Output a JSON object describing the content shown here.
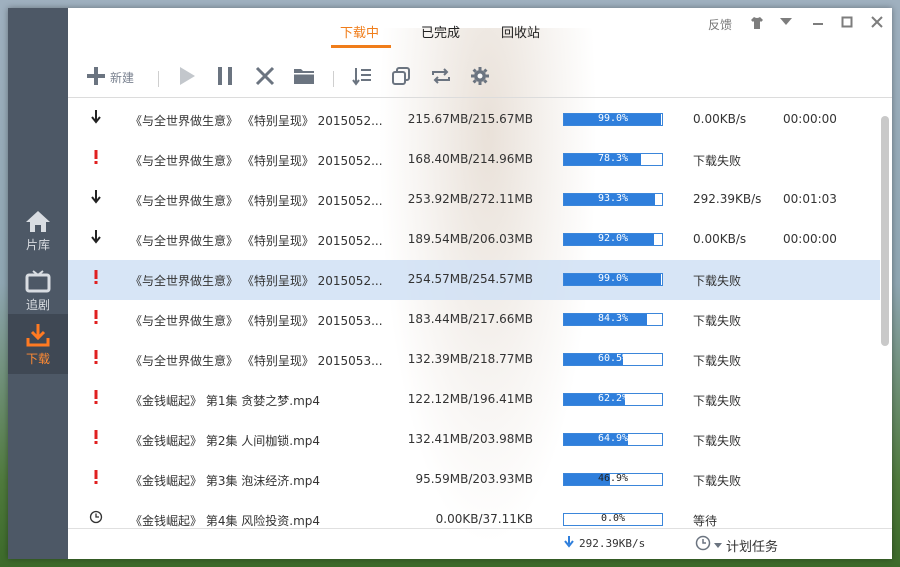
{
  "sidebar": {
    "items": [
      {
        "label": "片库",
        "icon": "home-icon"
      },
      {
        "label": "追剧",
        "icon": "tv-icon"
      },
      {
        "label": "下载",
        "icon": "download-icon",
        "active": true
      }
    ]
  },
  "tabs": [
    {
      "label": "下载中",
      "active": true
    },
    {
      "label": "已完成"
    },
    {
      "label": "回收站"
    }
  ],
  "window_controls": {
    "feedback": "反馈",
    "icons": [
      "shirt-icon",
      "dropdown-icon",
      "minimize-icon",
      "maximize-icon",
      "close-icon"
    ]
  },
  "toolbar": {
    "new_label": "新建",
    "icons": [
      "plus-icon",
      "play-icon",
      "pause-icon",
      "delete-icon",
      "folder-icon",
      "sort-icon",
      "copy-icon",
      "repeat-icon",
      "settings-icon"
    ]
  },
  "downloads": [
    {
      "status": "downloading",
      "name": "《与全世界做生意》 《特别呈现》 2015052...",
      "size": "215.67MB/215.67MB",
      "progress": 0.99,
      "progress_text": "99.0%",
      "speed": "0.00KB/s",
      "time": "00:00:00"
    },
    {
      "status": "error",
      "name": "《与全世界做生意》 《特别呈现》 2015052...",
      "size": "168.40MB/214.96MB",
      "progress": 0.783,
      "progress_text": "78.3%",
      "speed": "下载失败",
      "time": ""
    },
    {
      "status": "downloading",
      "name": "《与全世界做生意》 《特别呈现》 2015052...",
      "size": "253.92MB/272.11MB",
      "progress": 0.933,
      "progress_text": "93.3%",
      "speed": "292.39KB/s",
      "time": "00:01:03"
    },
    {
      "status": "downloading",
      "name": "《与全世界做生意》 《特别呈现》 2015052...",
      "size": "189.54MB/206.03MB",
      "progress": 0.92,
      "progress_text": "92.0%",
      "speed": "0.00KB/s",
      "time": "00:00:00"
    },
    {
      "status": "error",
      "name": "《与全世界做生意》 《特别呈现》 2015052...",
      "size": "254.57MB/254.57MB",
      "progress": 0.99,
      "progress_text": "99.0%",
      "speed": "下载失败",
      "time": "",
      "selected": true
    },
    {
      "status": "error",
      "name": "《与全世界做生意》 《特别呈现》 2015053...",
      "size": "183.44MB/217.66MB",
      "progress": 0.843,
      "progress_text": "84.3%",
      "speed": "下载失败",
      "time": ""
    },
    {
      "status": "error",
      "name": "《与全世界做生意》 《特别呈现》 2015053...",
      "size": "132.39MB/218.77MB",
      "progress": 0.605,
      "progress_text": "60.5%",
      "speed": "下载失败",
      "time": ""
    },
    {
      "status": "error",
      "name": "《金钱崛起》 第1集 贪婪之梦.mp4",
      "size": "122.12MB/196.41MB",
      "progress": 0.622,
      "progress_text": "62.2%",
      "speed": "下载失败",
      "time": ""
    },
    {
      "status": "error",
      "name": "《金钱崛起》 第2集 人间枷锁.mp4",
      "size": "132.41MB/203.98MB",
      "progress": 0.649,
      "progress_text": "64.9%",
      "speed": "下载失败",
      "time": ""
    },
    {
      "status": "error",
      "name": "《金钱崛起》 第3集 泡沫经济.mp4",
      "size": "95.59MB/203.93MB",
      "progress": 0.469,
      "progress_text": "46.9%",
      "speed": "下载失败",
      "time": ""
    },
    {
      "status": "waiting",
      "name": "《金钱崛起》 第4集 风险投资.mp4",
      "size": "0.00KB/37.11KB",
      "progress": 0.0,
      "progress_text": "0.0%",
      "speed": "等待",
      "time": ""
    }
  ],
  "statusbar": {
    "total_speed": "292.39KB/s",
    "schedule_label": "计划任务"
  },
  "colors": {
    "accent": "#f07d1a",
    "progress": "#2f7fdc",
    "error": "#e02020",
    "sidebar": "#4d5866"
  }
}
